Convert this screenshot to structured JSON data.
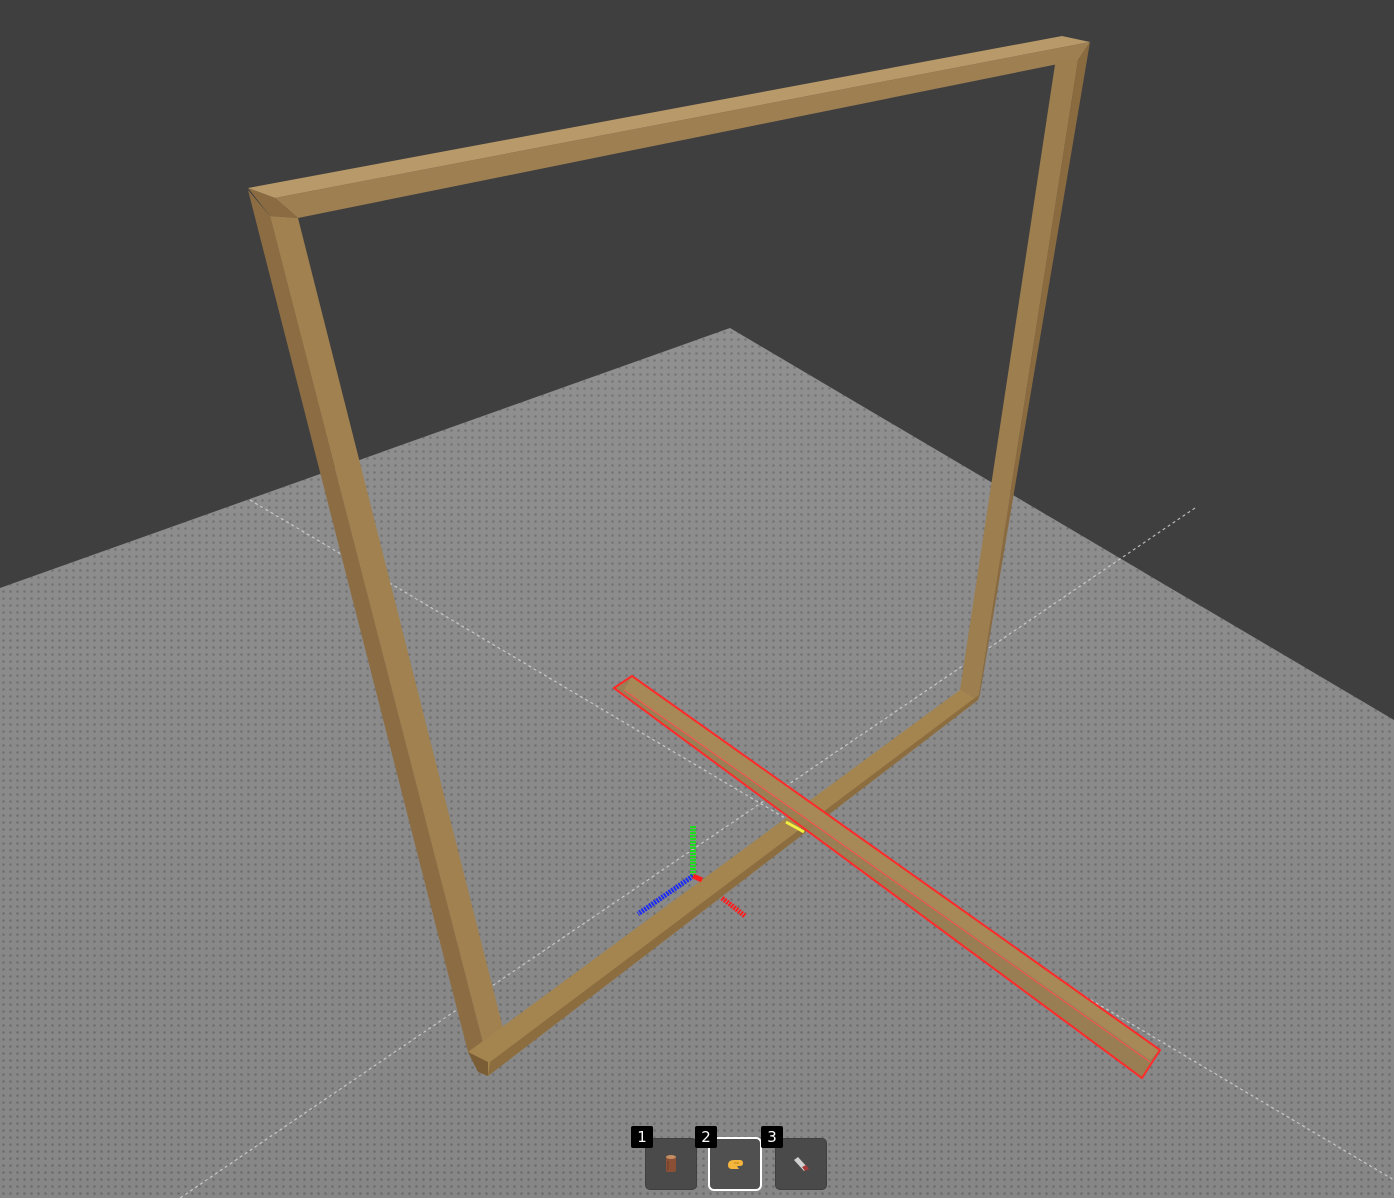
{
  "scene": {
    "background_color": "#3f3f3f",
    "floor_color": "#8a8a8a",
    "wood_color": "#9b7d4f",
    "selection_color": "#ff3b3b",
    "gizmo": {
      "x_axis_color": "#ff2020",
      "y_axis_color": "#20e020",
      "z_axis_color": "#2030ff"
    }
  },
  "hotbar": {
    "active_slot": 2,
    "slots": [
      {
        "number": "1",
        "icon": "log-icon"
      },
      {
        "number": "2",
        "icon": "hand-grab-icon"
      },
      {
        "number": "3",
        "icon": "saw-icon"
      }
    ]
  }
}
